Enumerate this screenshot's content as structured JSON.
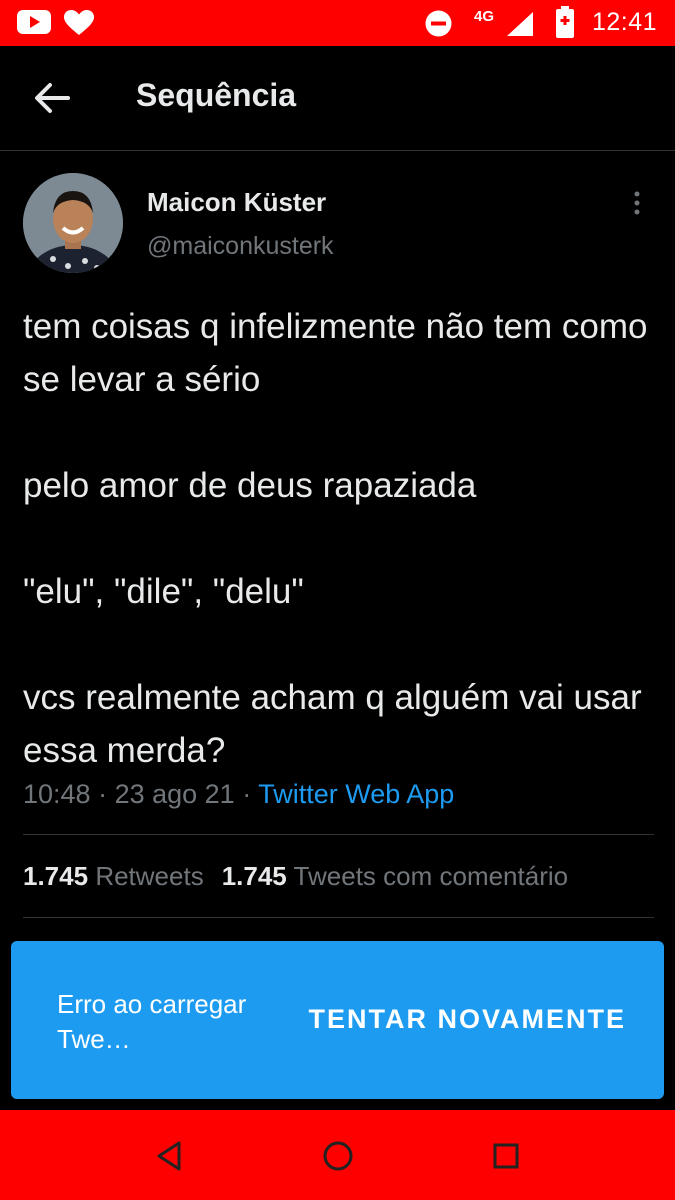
{
  "status_bar": {
    "time": "12:41",
    "network": "4G",
    "icons": [
      "youtube-icon",
      "heart-icon",
      "do-not-disturb-icon",
      "signal-icon",
      "battery-icon"
    ]
  },
  "header": {
    "title": "Sequência",
    "back_icon": "arrow-left-icon"
  },
  "tweet": {
    "author_name": "Maicon Küster",
    "author_handle": "@maiconkusterk",
    "text_paragraphs": [
      "tem coisas q infelizmente não tem como se levar a sério",
      "pelo amor de deus rapaziada",
      "\"elu\", \"dile\", \"delu\"",
      "vcs realmente acham q alguém vai usar essa merda?"
    ],
    "time": "10:48",
    "date": "23 ago 21",
    "separator": " · ",
    "source": "Twitter Web App",
    "retweets_count": "1.745",
    "retweets_label": "Retweets",
    "quotes_count": "1.745",
    "quotes_label": "Tweets com comentário"
  },
  "snackbar": {
    "message": "Erro ao carregar Twe…",
    "action": "TENTAR NOVAMENTE"
  },
  "nav_bar": {
    "icons": [
      "back-triangle-icon",
      "home-circle-icon",
      "recents-square-icon"
    ]
  },
  "colors": {
    "status_bar": "#ff0000",
    "background": "#000000",
    "accent": "#1d9bf0",
    "text": "#e7e9ea",
    "secondary_text": "#71767b"
  }
}
